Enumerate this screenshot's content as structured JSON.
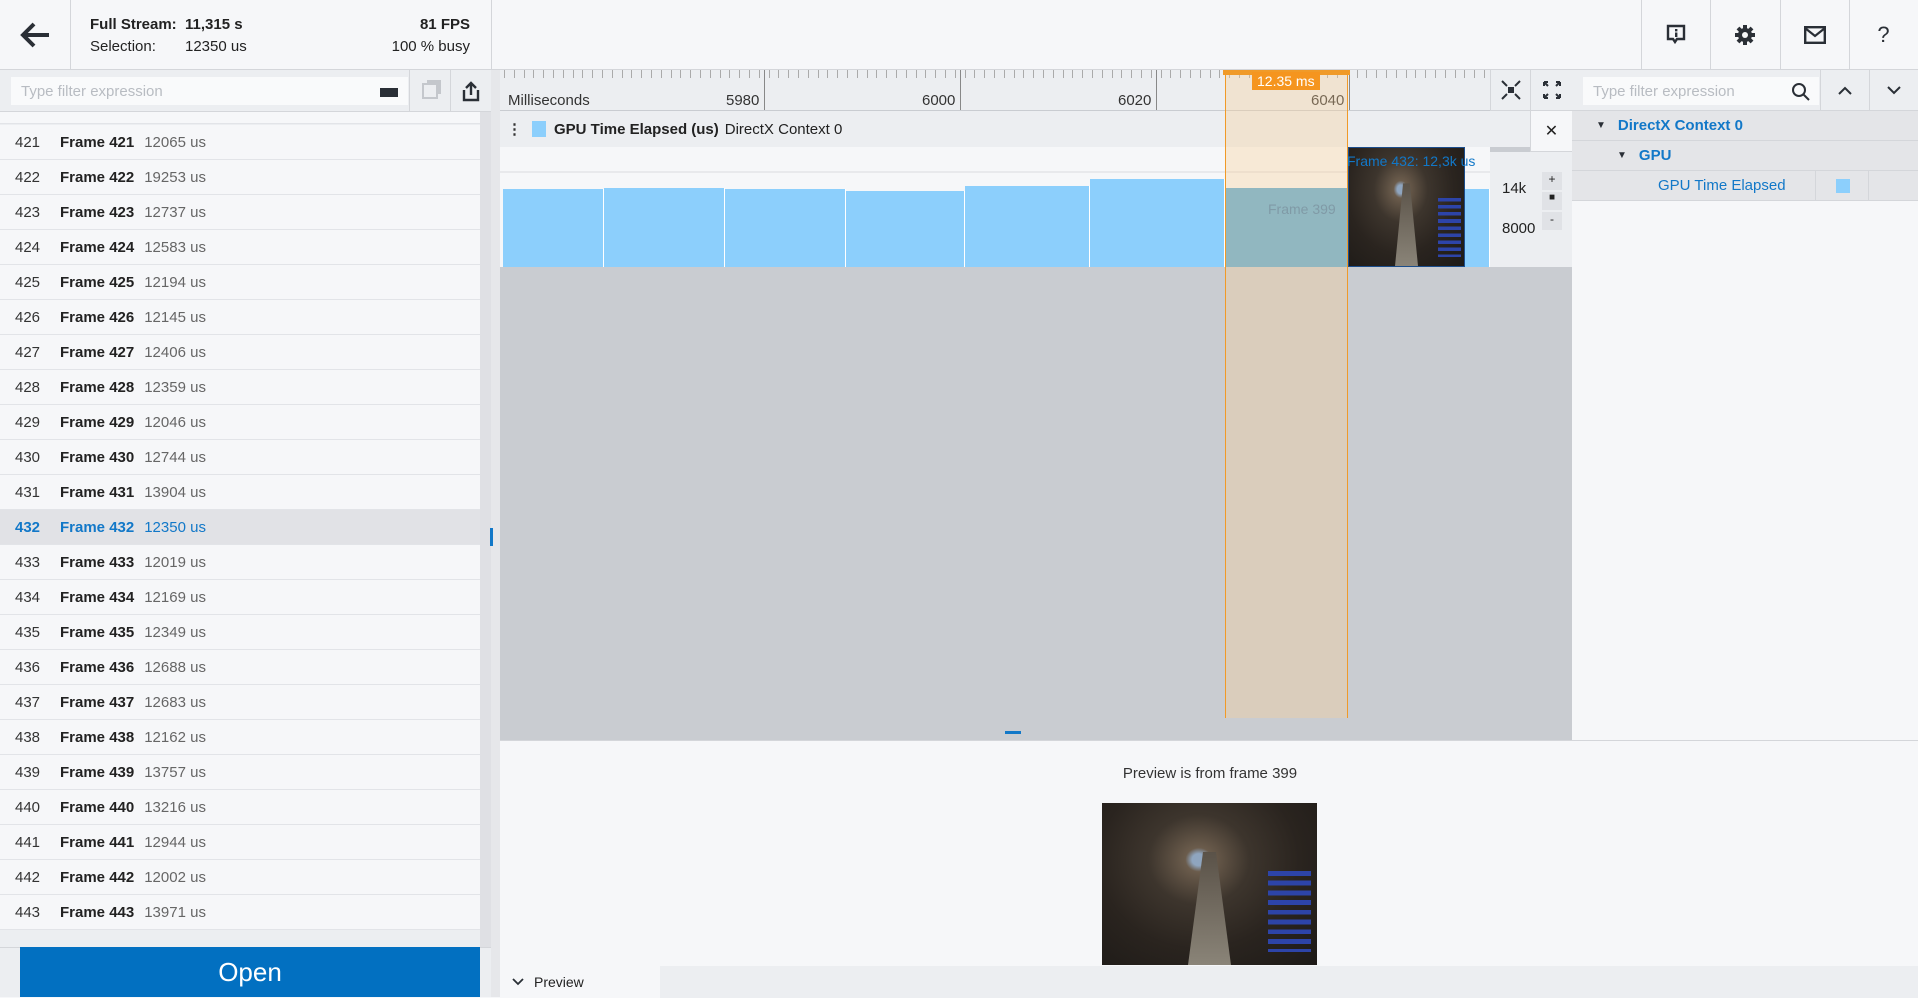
{
  "header": {
    "full_stream_label": "Full Stream:",
    "full_stream_value": "11,315 s",
    "selection_label": "Selection:",
    "selection_value": "12350 us",
    "fps": "81 FPS",
    "busy": "100 % busy",
    "icons": [
      "back-arrow-icon",
      "info-icon",
      "gear-icon",
      "mail-icon",
      "help-icon"
    ],
    "help_label": "?"
  },
  "left": {
    "filter_placeholder": "Type filter expression",
    "frames": [
      {
        "n": "421",
        "name": "Frame 421",
        "value": "12065 us"
      },
      {
        "n": "422",
        "name": "Frame 422",
        "value": "19253 us"
      },
      {
        "n": "423",
        "name": "Frame 423",
        "value": "12737 us"
      },
      {
        "n": "424",
        "name": "Frame 424",
        "value": "12583 us"
      },
      {
        "n": "425",
        "name": "Frame 425",
        "value": "12194 us"
      },
      {
        "n": "426",
        "name": "Frame 426",
        "value": "12145 us"
      },
      {
        "n": "427",
        "name": "Frame 427",
        "value": "12406 us"
      },
      {
        "n": "428",
        "name": "Frame 428",
        "value": "12359 us"
      },
      {
        "n": "429",
        "name": "Frame 429",
        "value": "12046 us"
      },
      {
        "n": "430",
        "name": "Frame 430",
        "value": "12744 us"
      },
      {
        "n": "431",
        "name": "Frame 431",
        "value": "13904 us"
      },
      {
        "n": "432",
        "name": "Frame 432",
        "value": "12350 us",
        "selected": true
      },
      {
        "n": "433",
        "name": "Frame 433",
        "value": "12019 us"
      },
      {
        "n": "434",
        "name": "Frame 434",
        "value": "12169 us"
      },
      {
        "n": "435",
        "name": "Frame 435",
        "value": "12349 us"
      },
      {
        "n": "436",
        "name": "Frame 436",
        "value": "12688 us"
      },
      {
        "n": "437",
        "name": "Frame 437",
        "value": "12683 us"
      },
      {
        "n": "438",
        "name": "Frame 438",
        "value": "12162 us"
      },
      {
        "n": "439",
        "name": "Frame 439",
        "value": "13757 us"
      },
      {
        "n": "440",
        "name": "Frame 440",
        "value": "13216 us"
      },
      {
        "n": "441",
        "name": "Frame 441",
        "value": "12944 us"
      },
      {
        "n": "442",
        "name": "Frame 442",
        "value": "12002 us"
      },
      {
        "n": "443",
        "name": "Frame 443",
        "value": "13971 us"
      }
    ],
    "open_label": "Open"
  },
  "timeline": {
    "unit_label": "Milliseconds",
    "ticks": [
      "5980",
      "6000",
      "6020",
      "6040"
    ],
    "selection_label": "12.35 ms",
    "track_title": "GPU Time Elapsed (us)",
    "track_context": "DirectX Context 0",
    "track_color": "#8ccffc",
    "hover_label": "Frame 432: 12,3k us",
    "preview_frame_label": "Frame 399",
    "axis_labels": [
      "14k",
      "8000"
    ],
    "axis_buttons": [
      "+",
      "-"
    ],
    "bar_values_us": [
      13850,
      14000,
      13850,
      13550,
      14300,
      15400,
      14000,
      15400,
      13850
    ],
    "close_label": "✕"
  },
  "right": {
    "filter_placeholder": "Type filter expression",
    "tree": [
      {
        "label": "DirectX Context 0"
      },
      {
        "label": "GPU"
      },
      {
        "label": "GPU Time Elapsed",
        "color": "#8ccffc"
      }
    ]
  },
  "preview": {
    "caption": "Preview is from frame 399",
    "expander_label": "Preview"
  }
}
